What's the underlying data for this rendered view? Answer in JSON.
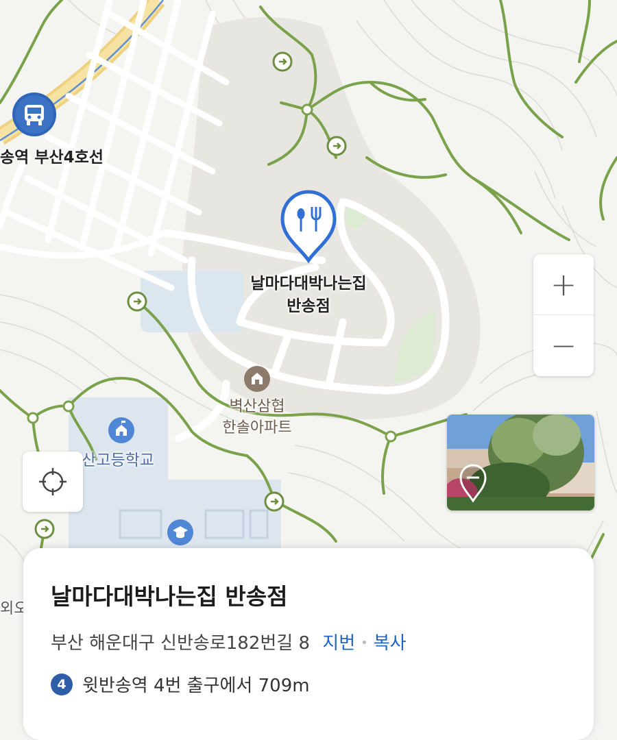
{
  "map": {
    "labels": {
      "restaurant_name_line1": "날마다대박나는집",
      "restaurant_name_line2": "반송점",
      "apartment_line1": "벽산삼협",
      "apartment_line2": "한솔아파트",
      "station_partial": "송역 부산4호선",
      "school_partial": "영산고등학교",
      "edge_partial": "외오"
    }
  },
  "controls": {
    "zoom_in": "+",
    "zoom_out": "−"
  },
  "place_card": {
    "name": "날마다대박나는집 반송점",
    "address": "부산 해운대구 신반송로182번길 8",
    "jibun_link": "지번",
    "separator": "•",
    "copy_link": "복사",
    "subway_line": "4",
    "subway_info": "윗반송역 4번 출구에서 709m"
  },
  "colors": {
    "trail_green": "#7aa24a",
    "accent_blue": "#2f6fd6",
    "link_blue": "#1f64c9",
    "line4_blue": "#2f5ea9"
  }
}
